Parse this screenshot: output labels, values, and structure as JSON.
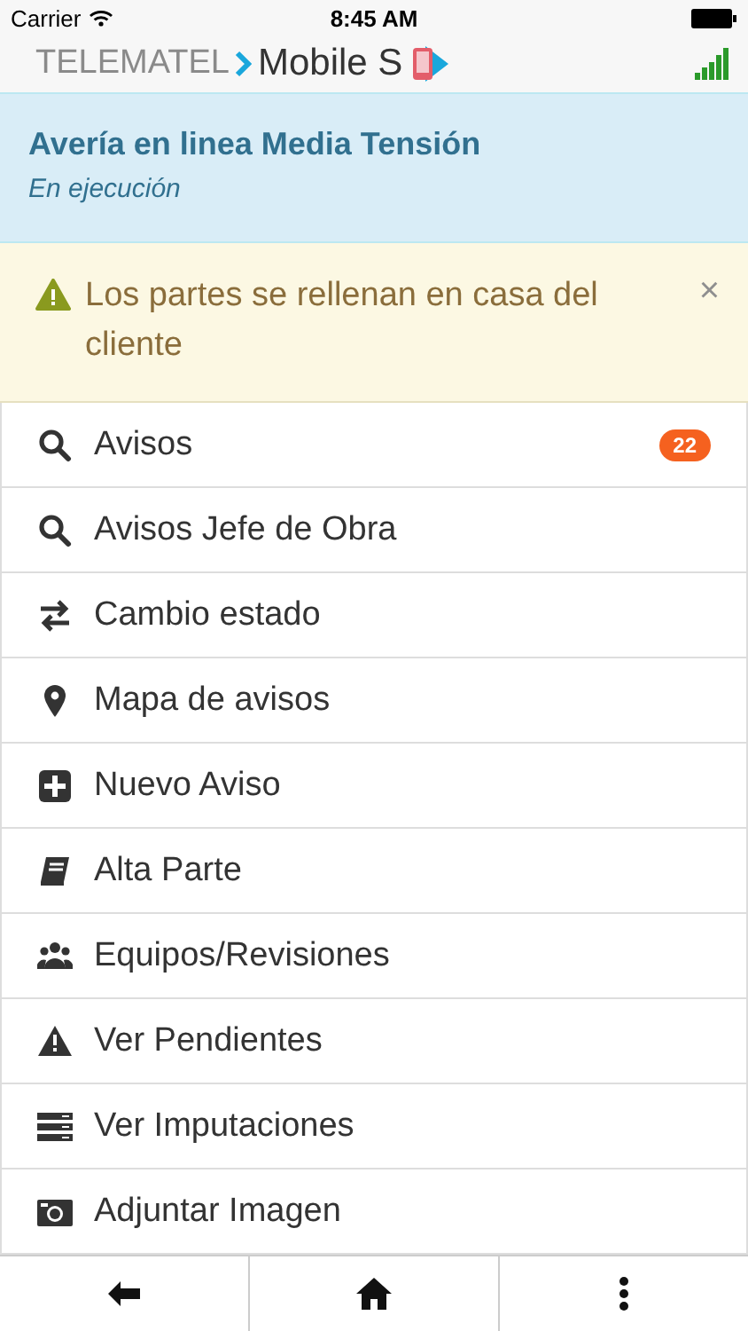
{
  "status_bar": {
    "carrier": "Carrier",
    "time": "8:45 AM"
  },
  "logo": {
    "brand": "TELEMATEL",
    "product": "Mobile S"
  },
  "job": {
    "title": "Avería en linea Media Tensión",
    "status": "En ejecución"
  },
  "alert": {
    "text": "Los partes se rellenan en casa del cliente",
    "close": "×"
  },
  "menu": [
    {
      "label": "Avisos",
      "badge": "22"
    },
    {
      "label": "Avisos Jefe de Obra"
    },
    {
      "label": "Cambio estado"
    },
    {
      "label": "Mapa de avisos"
    },
    {
      "label": "Nuevo Aviso"
    },
    {
      "label": "Alta Parte"
    },
    {
      "label": "Equipos/Revisiones"
    },
    {
      "label": "Ver Pendientes"
    },
    {
      "label": "Ver Imputaciones"
    },
    {
      "label": "Adjuntar Imagen"
    }
  ]
}
